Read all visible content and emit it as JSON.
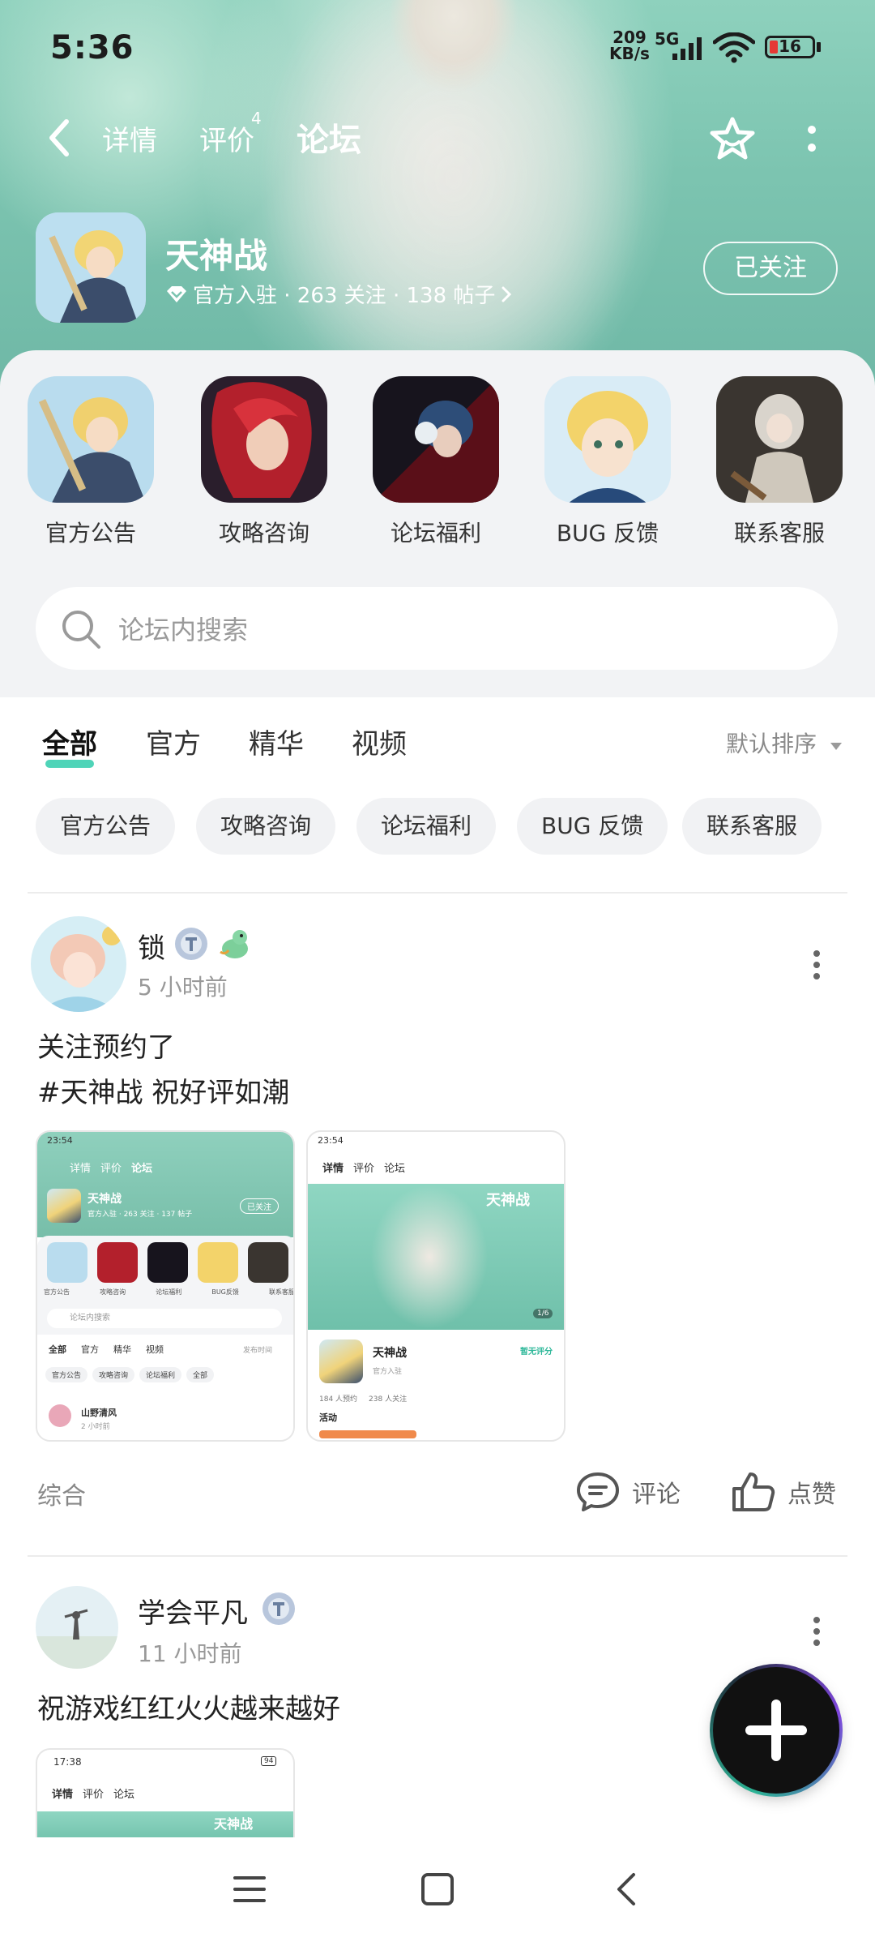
{
  "status_bar": {
    "time": "5:36",
    "net_speed_value": "209",
    "net_speed_unit": "KB/s",
    "network": "5G",
    "battery": "16"
  },
  "header": {
    "tabs": [
      {
        "label": "详情",
        "badge": ""
      },
      {
        "label": "评价",
        "badge": "4"
      },
      {
        "label": "论坛",
        "badge": ""
      }
    ],
    "active_tab": "论坛"
  },
  "game": {
    "name": "天神战",
    "meta": "官方入驻 · 263 关注 · 138 帖子",
    "follow_label": "已关注"
  },
  "shortcuts": [
    {
      "label": "官方公告",
      "icon": "official-announcement-icon"
    },
    {
      "label": "攻略咨询",
      "icon": "strategy-icon"
    },
    {
      "label": "论坛福利",
      "icon": "forum-benefits-icon"
    },
    {
      "label": "BUG 反馈",
      "icon": "bug-feedback-icon"
    },
    {
      "label": "联系客服",
      "icon": "customer-service-icon"
    }
  ],
  "search": {
    "placeholder": "论坛内搜索"
  },
  "filter_tabs": [
    {
      "label": "全部",
      "active": true
    },
    {
      "label": "官方",
      "active": false
    },
    {
      "label": "精华",
      "active": false
    },
    {
      "label": "视频",
      "active": false
    }
  ],
  "sort_label": "默认排序",
  "chips": [
    "官方公告",
    "攻略咨询",
    "论坛福利",
    "BUG 反馈",
    "联系客服"
  ],
  "posts": [
    {
      "author": "锁",
      "time": "5 小时前",
      "lines": [
        "关注预约了",
        "#天神战 祝好评如潮"
      ],
      "category": "综合",
      "comment_label": "评论",
      "like_label": "点赞",
      "thumb1": {
        "time": "23:54",
        "tabs": [
          "详情",
          "评价",
          "论坛"
        ],
        "game": "天神战",
        "meta": "官方入驻 · 263 关注 · 137 帖子",
        "follow": "已关注",
        "shortcuts": [
          "官方公告",
          "攻略咨询",
          "论坛福利",
          "BUG反馈",
          "联系客服"
        ],
        "search": "论坛内搜索",
        "filters": [
          "全部",
          "官方",
          "精华",
          "视频"
        ],
        "sort": "发布时间",
        "chips": [
          "官方公告",
          "攻略咨询",
          "论坛福利",
          "全部"
        ],
        "user": "山野清风",
        "user_time": "2 小时前"
      },
      "thumb2": {
        "time": "23:54",
        "tabs": [
          "详情",
          "评价",
          "论坛"
        ],
        "banner_title": "天神战",
        "counter": "1/6",
        "game": "天神战",
        "rating": "暂无评分",
        "official": "官方入驻",
        "stats": [
          "184 人预约",
          "238 人关注"
        ],
        "activity": "活动"
      }
    },
    {
      "author": "学会平凡",
      "time": "11 小时前",
      "lines": [
        "祝游戏红红火火越来越好"
      ],
      "thumb": {
        "time": "17:38",
        "tabs": [
          "详情",
          "评价",
          "论坛"
        ],
        "banner_title": "天神战",
        "battery": "94"
      }
    }
  ],
  "colors": {
    "accent": "#39d4b2",
    "hero_bg": "#7cc4b0",
    "panel_bg": "#f2f3f5"
  }
}
